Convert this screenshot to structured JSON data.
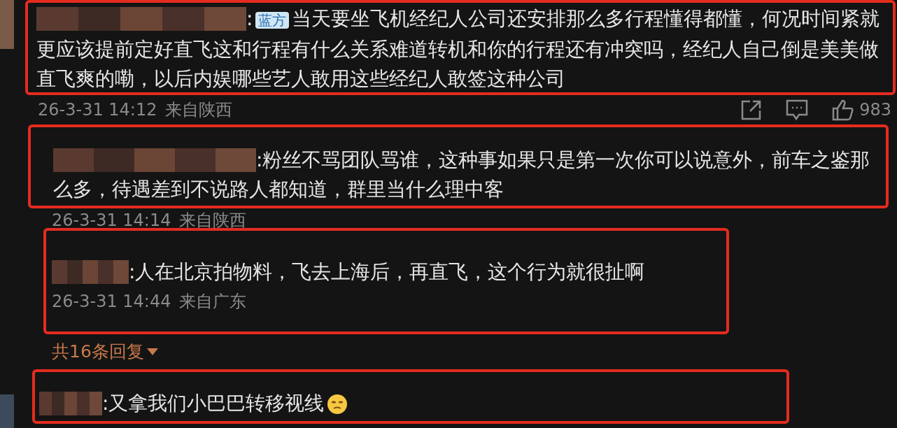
{
  "comments": [
    {
      "lead": ":",
      "badge": "蓝方",
      "text": "当天要坐飞机经纪人公司还安排那么多行程懂得都懂，何况时间紧就更应该提前定好直飞这和行程有什么关系难道转机和你的行程还有冲突吗，经纪人自己倒是美美做直飞爽的嘞，以后内娱哪些艺人敢用这些经纪人敢签这种公司",
      "time": "26-3-31 14:12",
      "location": "来自陕西",
      "likes": "983",
      "emoji": false
    },
    {
      "lead": ":",
      "text": "粉丝不骂团队骂谁，这种事如果只是第一次你可以说意外，前车之鉴那么多，待遇差到不说路人都知道，群里当什么理中客",
      "time": "26-3-31 14:14",
      "location": "来自陕西",
      "emoji": false
    },
    {
      "lead": ":",
      "text": "人在北京拍物料，飞去上海后，再直飞，这个行为就很扯啊",
      "time": "26-3-31 14:44",
      "location": "来自广东",
      "emoji": false
    },
    {
      "lead": ":",
      "text": "又拿我们小巴巴转移视线",
      "emoji": true
    }
  ],
  "replies_link": "共16条回复"
}
